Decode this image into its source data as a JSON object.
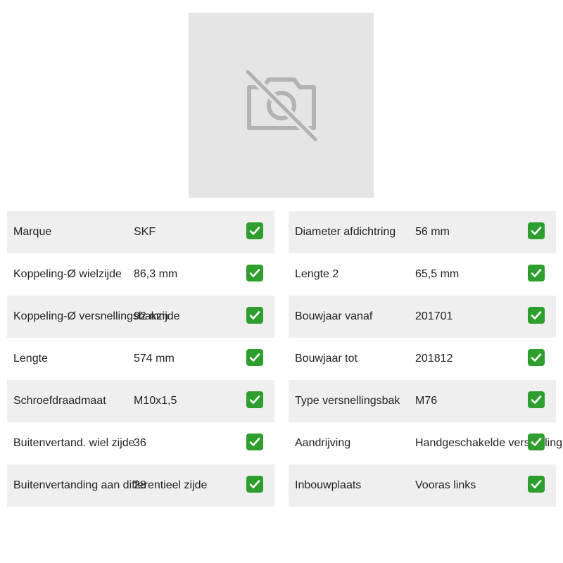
{
  "image": {
    "icon": "no-camera-icon"
  },
  "specs_left": [
    {
      "label": "Marque",
      "value": "SKF"
    },
    {
      "label": "Koppeling-Ø wielzijde",
      "value": "86,3 mm"
    },
    {
      "label": "Koppeling-Ø versnellingsbakzijde",
      "value": "92 mm"
    },
    {
      "label": "Lengte",
      "value": "574 mm"
    },
    {
      "label": "Schroefdraadmaat",
      "value": "M10x1,5"
    },
    {
      "label": "Buitenvertand. wiel zijde",
      "value": "36"
    },
    {
      "label": "Buitenvertanding aan differentieel zijde",
      "value": "28"
    }
  ],
  "specs_right": [
    {
      "label": "Diameter afdichtring",
      "value": "56 mm"
    },
    {
      "label": "Lengte 2",
      "value": "65,5 mm"
    },
    {
      "label": "Bouwjaar vanaf",
      "value": "201701"
    },
    {
      "label": "Bouwjaar tot",
      "value": "201812"
    },
    {
      "label": "Type versnellingsbak",
      "value": "M76"
    },
    {
      "label": "Aandrijving",
      "value": "Handgeschakelde versnelling"
    },
    {
      "label": "Inbouwplaats",
      "value": "Vooras links"
    }
  ],
  "check_icon": "check-box-icon",
  "colors": {
    "check": "#2e9e2e",
    "row_shade": "#efefef",
    "placeholder": "#e5e5e5"
  }
}
